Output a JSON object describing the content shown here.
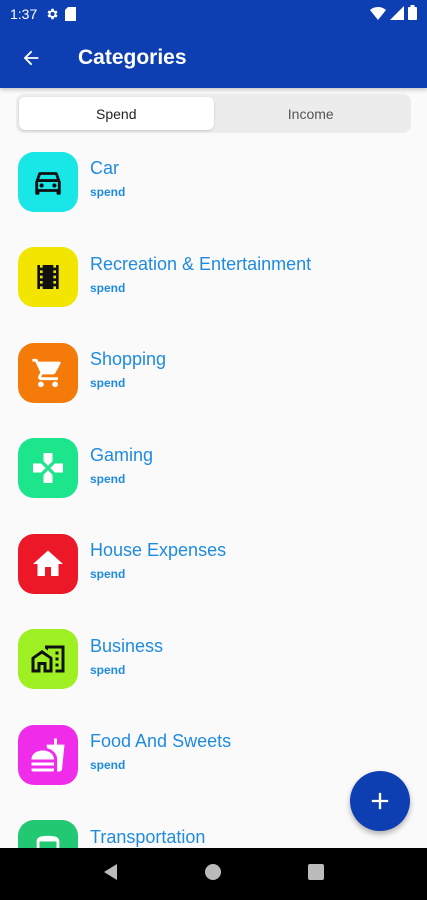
{
  "status_bar": {
    "time": "1:37"
  },
  "app_bar": {
    "title": "Categories"
  },
  "tabs": [
    {
      "label": "Spend",
      "active": true
    },
    {
      "label": "Income",
      "active": false
    }
  ],
  "categories": [
    {
      "name": "Car",
      "type": "spend",
      "color": "#19e6e6",
      "icon": "car-icon"
    },
    {
      "name": "Recreation & Entertainment",
      "type": "spend",
      "color": "#f2e600",
      "icon": "film-icon"
    },
    {
      "name": "Shopping",
      "type": "spend",
      "color": "#f47a0a",
      "icon": "shopping-cart-icon"
    },
    {
      "name": "Gaming",
      "type": "spend",
      "color": "#1de58c",
      "icon": "gamepad-icon"
    },
    {
      "name": "House Expenses",
      "type": "spend",
      "color": "#ec1727",
      "icon": "house-icon"
    },
    {
      "name": "Business",
      "type": "spend",
      "color": "#9ef023",
      "icon": "business-icon"
    },
    {
      "name": "Food And Sweets",
      "type": "spend",
      "color": "#ee2cea",
      "icon": "fastfood-icon"
    },
    {
      "name": "Transportation",
      "type": "spend",
      "color": "#22c872",
      "icon": "bus-icon"
    }
  ],
  "colors": {
    "primary": "#0d3fb3",
    "accent_text": "#1f8be0"
  }
}
